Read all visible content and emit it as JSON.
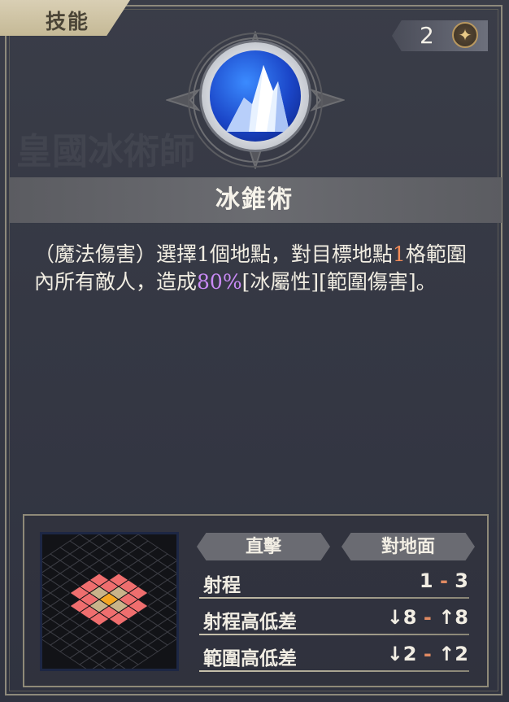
{
  "tab": {
    "label": "技能"
  },
  "cost": {
    "value": "2",
    "icon": "star-icon"
  },
  "skill": {
    "name": "冰錐術",
    "icon": "ice-crystal-icon",
    "description": {
      "p1": "（魔法傷害）選擇1個地點，對目標地點",
      "n1": "1",
      "p2": "格範圍內所有敵人，造成",
      "n2": "80%",
      "p3": "[冰屬性][範圍傷害]。"
    }
  },
  "stats": {
    "tags": [
      "直擊",
      "對地面"
    ],
    "rows": [
      {
        "label": "射程",
        "low": "1",
        "high": "3",
        "low_prefix": "",
        "high_prefix": ""
      },
      {
        "label": "射程高低差",
        "low": "8",
        "high": "8",
        "low_prefix": "↓",
        "high_prefix": "↑"
      },
      {
        "label": "範圍高低差",
        "low": "2",
        "high": "2",
        "low_prefix": "↓",
        "high_prefix": "↑"
      }
    ],
    "separator": "-"
  },
  "colors": {
    "accent_number": "#f08a58",
    "accent_percent": "#c98af5",
    "area_tile": "#ef6e6e",
    "center_tile": "#f5a623"
  }
}
